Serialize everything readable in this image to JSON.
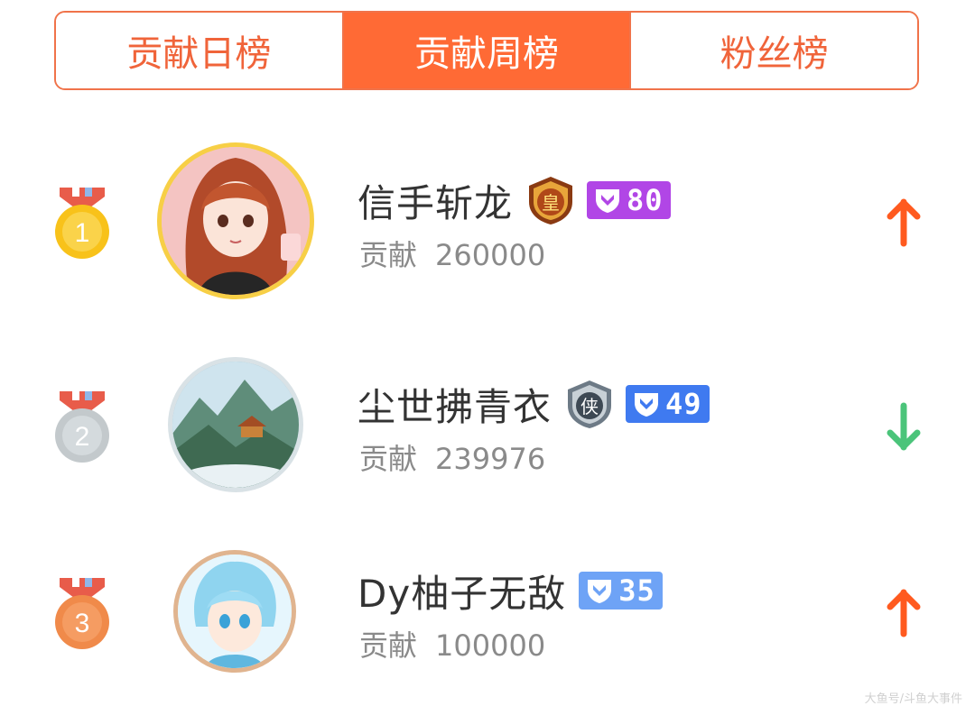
{
  "tabs": [
    {
      "label": "贡献日榜",
      "active": false
    },
    {
      "label": "贡献周榜",
      "active": true
    },
    {
      "label": "粉丝榜",
      "active": false
    }
  ],
  "ranking": [
    {
      "rank": "1",
      "name": "信手斩龙",
      "noble_badge": "皇",
      "level": "80",
      "level_color": "#b146e6",
      "contrib_label": "贡献",
      "contrib_value": "260000",
      "trend": "up",
      "trend_color": "#ff5a1f"
    },
    {
      "rank": "2",
      "name": "尘世拂青衣",
      "noble_badge": "侠",
      "level": "49",
      "level_color": "#3f7af0",
      "contrib_label": "贡献",
      "contrib_value": "239976",
      "trend": "down",
      "trend_color": "#4bc47a"
    },
    {
      "rank": "3",
      "name": "Dy柚子无敌",
      "noble_badge": "",
      "level": "35",
      "level_color": "#6ea3f6",
      "contrib_label": "贡献",
      "contrib_value": "100000",
      "trend": "up",
      "trend_color": "#ff5a1f"
    }
  ],
  "watermark": "大鱼号/斗鱼大事件"
}
